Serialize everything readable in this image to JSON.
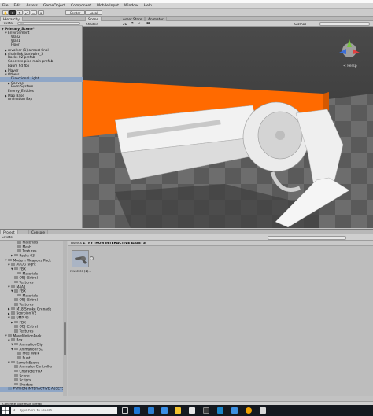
{
  "menu": [
    "File",
    "Edit",
    "Assets",
    "GameObject",
    "Component",
    "Mobile Input",
    "Window",
    "Help"
  ],
  "toolbar": {
    "pivot_label": "Center",
    "space_label": "Local"
  },
  "hierarchy": {
    "tab_label": "Hierarchy",
    "create_label": "Create",
    "search_placeholder": "All",
    "items": [
      {
        "label": "Primary_Scene*",
        "indent": 0,
        "arrow": "▼",
        "bold": true
      },
      {
        "label": "Environment",
        "indent": 1,
        "arrow": "▼"
      },
      {
        "label": "Wall2",
        "indent": 2,
        "arrow": ""
      },
      {
        "label": "Wall1",
        "indent": 2,
        "arrow": ""
      },
      {
        "label": "Floor",
        "indent": 2,
        "arrow": ""
      },
      {
        "label": "revolver (1) almost final",
        "indent": 1,
        "arrow": "▶"
      },
      {
        "label": "chainlink_barbwire_3",
        "indent": 1,
        "arrow": "▶"
      },
      {
        "label": "Rocks 02 prefab",
        "indent": 1,
        "arrow": ""
      },
      {
        "label": "Concrete pipe main prefab",
        "indent": 1,
        "arrow": ""
      },
      {
        "label": "baum hd fbx",
        "indent": 1,
        "arrow": ""
      },
      {
        "label": "Player",
        "indent": 1,
        "arrow": "▶"
      },
      {
        "label": "Others",
        "indent": 1,
        "arrow": "▼"
      },
      {
        "label": "Directional Light",
        "indent": 2,
        "arrow": "",
        "selected": true
      },
      {
        "label": "Canvas",
        "indent": 2,
        "arrow": "▶"
      },
      {
        "label": "EventSystem",
        "indent": 2,
        "arrow": ""
      },
      {
        "label": "Enemy_Entities",
        "indent": 1,
        "arrow": ""
      },
      {
        "label": "Map Base",
        "indent": 1,
        "arrow": "▶"
      },
      {
        "label": "Animation Exp",
        "indent": 1,
        "arrow": ""
      }
    ]
  },
  "scene": {
    "tabs": [
      "Scene",
      "Asset Store",
      "Animator"
    ],
    "shading_label": "Shaded",
    "mode_2d": "2D",
    "gizmos_label": "Gizmos",
    "persp_label": "< Persp"
  },
  "project": {
    "tabs": [
      "Project",
      "Console"
    ],
    "create_label": "Create",
    "breadcrumb_root": "Assets",
    "breadcrumb_sep": "►",
    "breadcrumb_folder": "PYTHON INTERACTIVE ASSETS",
    "tree": [
      {
        "label": "Materials",
        "indent": 4,
        "arrow": ""
      },
      {
        "label": "Mesh",
        "indent": 4,
        "arrow": ""
      },
      {
        "label": "Textures",
        "indent": 4,
        "arrow": ""
      },
      {
        "label": "Rocks 03",
        "indent": 3,
        "arrow": "▶"
      },
      {
        "label": "Modern Weapons Pack",
        "indent": 1,
        "arrow": "▼"
      },
      {
        "label": "ACOG Sight",
        "indent": 2,
        "arrow": "▼"
      },
      {
        "label": "FBX",
        "indent": 3,
        "arrow": "▼"
      },
      {
        "label": "Materials",
        "indent": 4,
        "arrow": ""
      },
      {
        "label": "OBJ (Extra)",
        "indent": 3,
        "arrow": ""
      },
      {
        "label": "Textures",
        "indent": 3,
        "arrow": ""
      },
      {
        "label": "M4A1",
        "indent": 2,
        "arrow": "▼"
      },
      {
        "label": "FBX",
        "indent": 3,
        "arrow": "▼"
      },
      {
        "label": "Materials",
        "indent": 4,
        "arrow": ""
      },
      {
        "label": "OBJ (Extra)",
        "indent": 3,
        "arrow": ""
      },
      {
        "label": "Textures",
        "indent": 3,
        "arrow": ""
      },
      {
        "label": "M18 Smoke Grenade",
        "indent": 2,
        "arrow": "▶"
      },
      {
        "label": "Scorpion V2",
        "indent": 2,
        "arrow": "▶"
      },
      {
        "label": "UMP-45",
        "indent": 2,
        "arrow": "▼"
      },
      {
        "label": "FBX",
        "indent": 3,
        "arrow": "▶"
      },
      {
        "label": "OBJ (Extra)",
        "indent": 3,
        "arrow": ""
      },
      {
        "label": "Textures",
        "indent": 3,
        "arrow": ""
      },
      {
        "label": "MoveMotionPack",
        "indent": 1,
        "arrow": "▼"
      },
      {
        "label": "Box",
        "indent": 2,
        "arrow": "▼"
      },
      {
        "label": "AnimationClip",
        "indent": 3,
        "arrow": "▼"
      },
      {
        "label": "AnimationFBX",
        "indent": 3,
        "arrow": "▼"
      },
      {
        "label": "Free_Walk",
        "indent": 4,
        "arrow": ""
      },
      {
        "label": "Runt",
        "indent": 4,
        "arrow": ""
      },
      {
        "label": "SampleScene",
        "indent": 2,
        "arrow": "▼"
      },
      {
        "label": "Animator Controller",
        "indent": 3,
        "arrow": ""
      },
      {
        "label": "CharacterFBX",
        "indent": 3,
        "arrow": ""
      },
      {
        "label": "Scene",
        "indent": 3,
        "arrow": ""
      },
      {
        "label": "Scripts",
        "indent": 3,
        "arrow": ""
      },
      {
        "label": "Shaders",
        "indent": 3,
        "arrow": ""
      },
      {
        "label": "PYTHON INTERACTIVE ASSETS",
        "indent": 1,
        "arrow": "",
        "selected": true
      }
    ],
    "asset_name": "revolver (1)..."
  },
  "status": {
    "text": "Concrete pipe main prefab"
  },
  "taskbar": {
    "search_placeholder": "Type here to search"
  }
}
